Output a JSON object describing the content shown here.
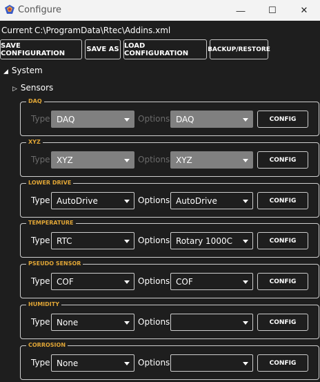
{
  "window": {
    "title": "Configure",
    "minimize_glyph": "—",
    "maximize_glyph": "☐",
    "close_glyph": "✕"
  },
  "current": {
    "label": "Current",
    "path": "C:\\ProgramData\\Rtec\\Addins.xml"
  },
  "toolbar": {
    "save_configuration": "SAVE CONFIGURATION",
    "save_as": "SAVE AS",
    "load_configuration": "LOAD CONFIGURATION",
    "backup_restore": "BACKUP/RESTORE"
  },
  "tree": {
    "system": "System",
    "sensors": "Sensors"
  },
  "labels": {
    "type": "Type",
    "options": "Options",
    "config": "CONFIG"
  },
  "groups": [
    {
      "title": "DAQ",
      "type": "DAQ",
      "options": "DAQ",
      "disabled": true
    },
    {
      "title": "XYZ",
      "type": "XYZ",
      "options": "XYZ",
      "disabled": true
    },
    {
      "title": "LOWER DRIVE",
      "type": "AutoDrive",
      "options": "AutoDrive",
      "disabled": false
    },
    {
      "title": "TEMPERATURE",
      "type": "RTC",
      "options": "Rotary 1000C",
      "disabled": false
    },
    {
      "title": "PSEUDO SENSOR",
      "type": "COF",
      "options": "COF",
      "disabled": false
    },
    {
      "title": "HUMIDITY",
      "type": "None",
      "options": "",
      "disabled": false
    },
    {
      "title": "CORROSION",
      "type": "None",
      "options": "",
      "disabled": false
    }
  ],
  "colors": {
    "accent_title": "#e1a636",
    "background": "#1e1e1e",
    "disabled_fill": "#808080"
  }
}
